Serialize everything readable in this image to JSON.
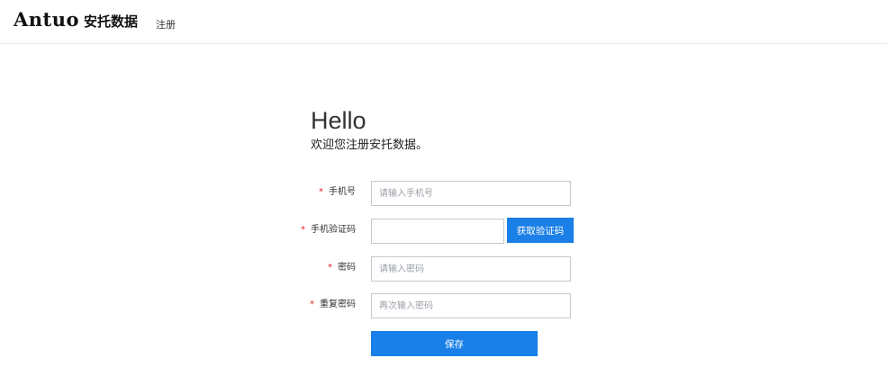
{
  "header": {
    "logo_en": "Antuo",
    "logo_cn": "安托数据",
    "nav_link": "注册"
  },
  "greeting": {
    "title": "Hello",
    "subtitle": "欢迎您注册安托数据。"
  },
  "form": {
    "required_mark": "*",
    "phone": {
      "label": "手机号",
      "value": "",
      "placeholder": "请输入手机号"
    },
    "code": {
      "label": "手机验证码",
      "value": "",
      "placeholder": "",
      "button_label": "获取验证码"
    },
    "password": {
      "label": "密码",
      "value": "",
      "placeholder": "请输入密码"
    },
    "repeat_password": {
      "label": "重复密码",
      "value": "",
      "placeholder": "再次输入密码"
    },
    "save_label": "保存"
  },
  "colors": {
    "primary": "#1a7fe6",
    "required": "#e02020",
    "border": "#c8c8c8"
  }
}
